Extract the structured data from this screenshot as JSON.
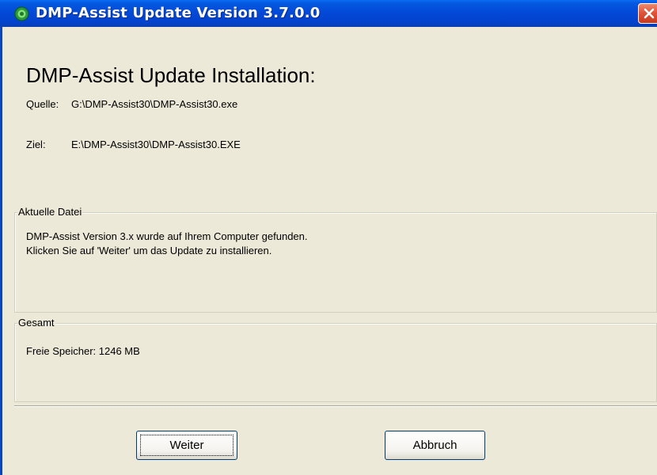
{
  "window": {
    "title": "DMP-Assist Update Version 3.7.0.0",
    "close_symbol": "✕"
  },
  "main": {
    "heading": "DMP-Assist Update Installation:",
    "source_label": "Quelle:",
    "source_path": "G:\\DMP-Assist30\\DMP-Assist30.exe",
    "target_label": "Ziel:",
    "target_path": "E:\\DMP-Assist30\\DMP-Assist30.EXE"
  },
  "current_file": {
    "legend": "Aktuelle Datei",
    "line1": "DMP-Assist Version 3.x wurde auf Ihrem Computer gefunden.",
    "line2": "Klicken Sie auf 'Weiter' um das Update zu installieren."
  },
  "total": {
    "legend": "Gesamt",
    "free_space": "Freie Speicher: 1246 MB"
  },
  "buttons": {
    "next": "Weiter",
    "cancel": "Abbruch"
  },
  "colors": {
    "titlebar": "#0348d6",
    "dialog_bg": "#ece9d8",
    "close_button": "#e0553a"
  },
  "icons": {
    "app": "gear-icon",
    "close": "close-icon"
  }
}
